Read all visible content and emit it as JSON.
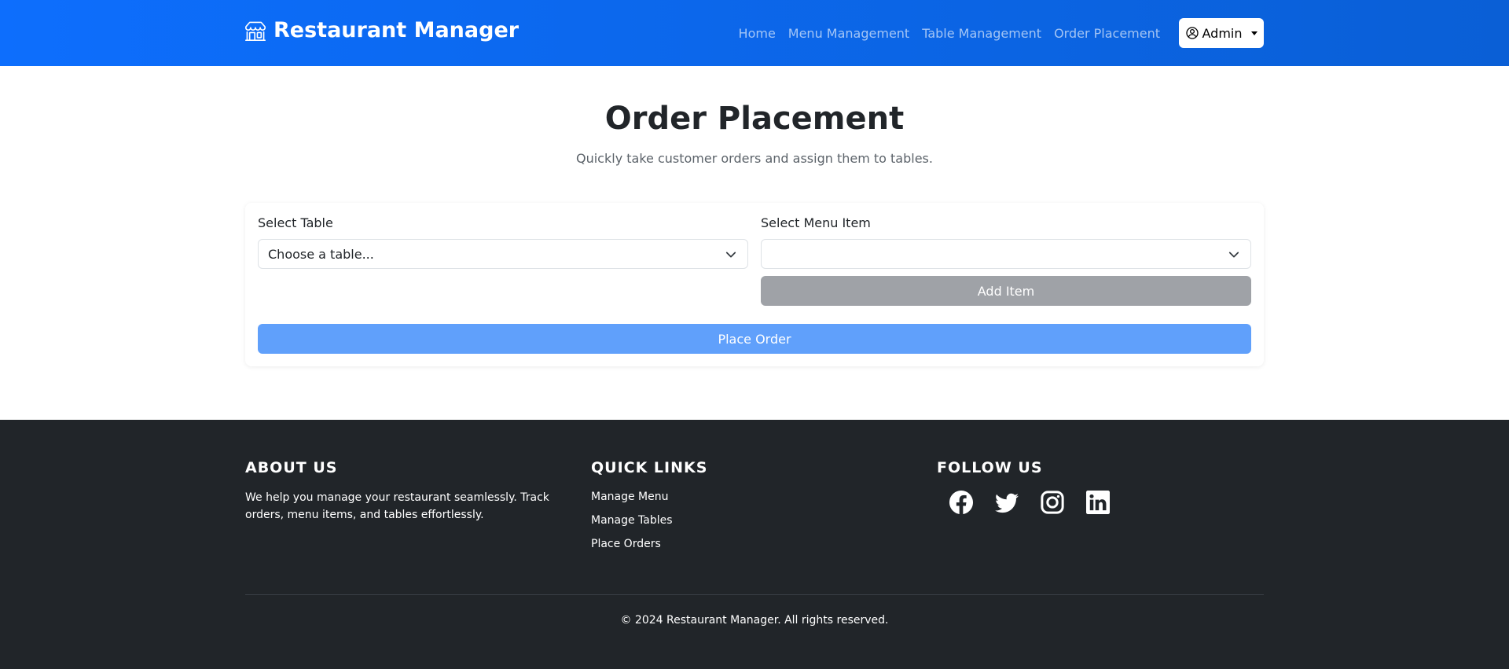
{
  "navbar": {
    "brand": "Restaurant Manager",
    "brand_icon": "shop-icon",
    "links": [
      "Home",
      "Menu Management",
      "Table Management",
      "Order Placement"
    ],
    "user_label": "Admin",
    "user_icon": "user-circle-icon"
  },
  "hero": {
    "title": "Order Placement",
    "subtitle": "Quickly take customer orders and assign them to tables."
  },
  "form": {
    "table_label": "Select Table",
    "table_value": "Choose a table...",
    "menu_label": "Select Menu Item",
    "menu_value": "",
    "add_button": "Add Item",
    "place_button": "Place Order"
  },
  "footer": {
    "about_heading": "ABOUT US",
    "about_text": "We help you manage your restaurant seamlessly. Track orders, menu items, and tables effortlessly.",
    "links_heading": "QUICK LINKS",
    "links": [
      "Manage Menu",
      "Manage Tables",
      "Place Orders"
    ],
    "follow_heading": "FOLLOW US",
    "social": [
      "facebook-icon",
      "twitter-icon",
      "instagram-icon",
      "linkedin-icon"
    ],
    "copyright": "© 2024 Restaurant Manager. All rights reserved."
  },
  "colors": {
    "navbar": "#0d6efd",
    "footer": "#212529",
    "primary_button": "#60a0fb",
    "secondary_button": "#9fa2a7"
  }
}
